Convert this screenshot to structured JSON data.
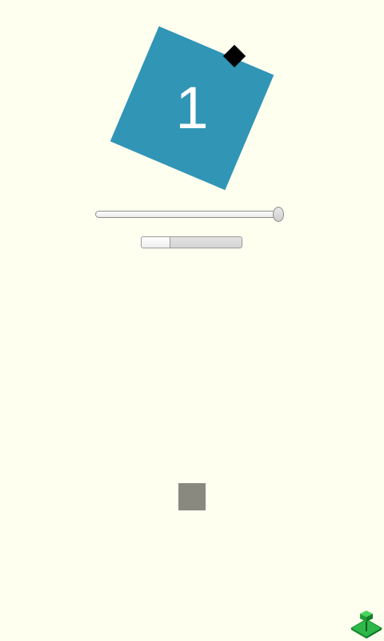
{
  "card": {
    "number": "1",
    "color": "#3195b6"
  },
  "slider": {
    "value_fraction": 0.97
  },
  "progress": {
    "value_fraction": 0.29
  },
  "colors": {
    "background": "#fffff0",
    "handle": "#000000",
    "square": "#8a8980",
    "corner_icon": "#2fb84a"
  },
  "icons": {
    "rotate_handle": "rotate-handle-icon",
    "corner": "isometric-blocks-icon"
  }
}
